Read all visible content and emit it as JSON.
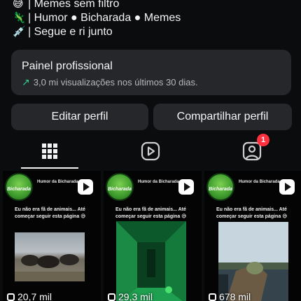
{
  "bio": {
    "lines": [
      {
        "emoji": "😅",
        "text": "| Memes sem filtro"
      },
      {
        "emoji": "🦎",
        "text": "| Humor ● Bicharada ● Memes"
      },
      {
        "emoji": "💉",
        "text": "| Segue e ri junto"
      }
    ]
  },
  "panel": {
    "title": "Painel profissional",
    "subtitle": "3,0 mi visualizações nos últimos 30 dias.",
    "arrow_icon": "↗"
  },
  "buttons": {
    "edit_profile": "Editar perfil",
    "share_profile": "Compartilhar perfil"
  },
  "tabs": {
    "active": "grid",
    "tagged_badge": "1"
  },
  "posts": [
    {
      "account": "Humor da Bicharada",
      "avatar_text": "Bicharada",
      "caption": "Eu não era fã de animais... Até começar seguir esta página 😅",
      "views": "20,7 mil"
    },
    {
      "account": "Humor da Bicharada",
      "avatar_text": "Bicharada",
      "caption": "Eu não era fã de animais... Até começar seguir esta página 😅",
      "views": "29,3 mil"
    },
    {
      "account": "Humor da Bicharada",
      "avatar_text": "Bicharada",
      "caption": "Eu não era fã de animais... Até começar seguir esta página 😅",
      "views": "678 mil"
    }
  ],
  "colors": {
    "background": "#0b0c0e",
    "card": "#26272b",
    "accent_green": "#2fcf8e",
    "badge_red": "#ff3040"
  }
}
